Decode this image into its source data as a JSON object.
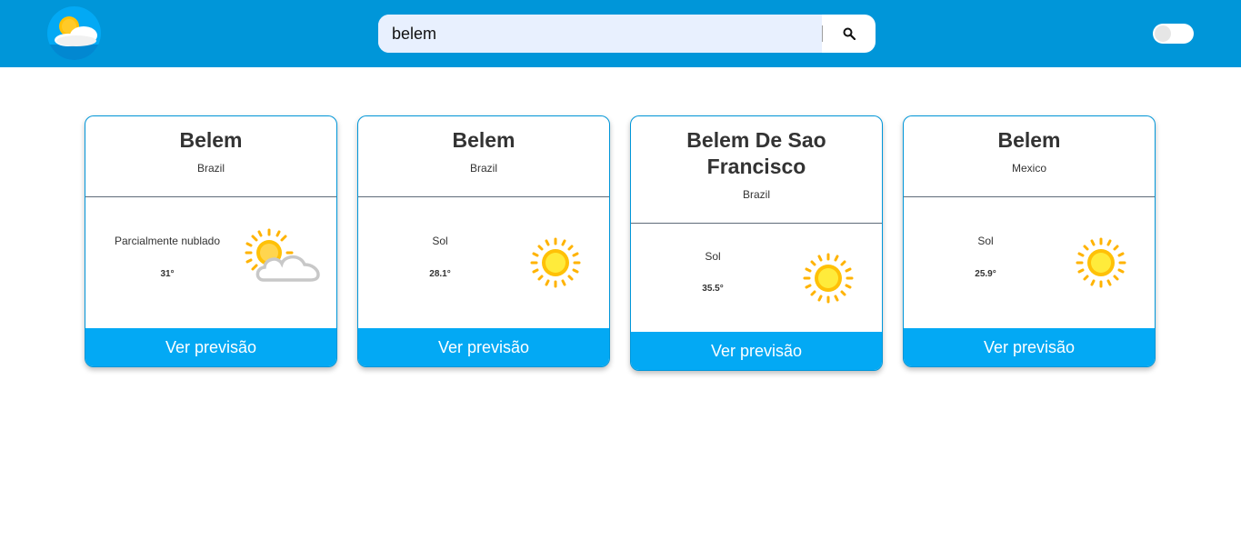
{
  "search": {
    "value": "belem",
    "placeholder": ""
  },
  "results": [
    {
      "city": "Belem",
      "country": "Brazil",
      "condition": "Parcialmente nublado",
      "temp": "31°",
      "icon": "partly-cloudy-icon",
      "button": "Ver previsão"
    },
    {
      "city": "Belem",
      "country": "Brazil",
      "condition": "Sol",
      "temp": "28.1°",
      "icon": "sun-icon",
      "button": "Ver previsão"
    },
    {
      "city": "Belem De Sao Francisco",
      "country": "Brazil",
      "condition": "Sol",
      "temp": "35.5°",
      "icon": "sun-icon",
      "button": "Ver previsão"
    },
    {
      "city": "Belem",
      "country": "Mexico",
      "condition": "Sol",
      "temp": "25.9°",
      "icon": "sun-icon",
      "button": "Ver previsão"
    }
  ],
  "colors": {
    "header": "#0096d9",
    "accent": "#03a9f4",
    "sun": "#ffc107",
    "cloud": "#d0d0d0"
  }
}
